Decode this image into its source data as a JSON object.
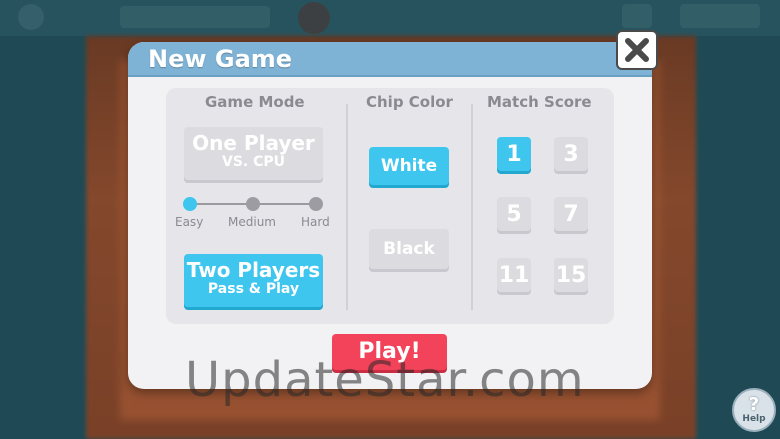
{
  "dialog": {
    "title": "New Game",
    "close_icon": "close-x-icon"
  },
  "game_mode": {
    "label": "Game Mode",
    "one_player": {
      "title": "One Player",
      "subtitle": "VS. CPU",
      "selected": false
    },
    "difficulty": {
      "options": [
        "Easy",
        "Medium",
        "Hard"
      ],
      "selected": "Easy"
    },
    "two_players": {
      "title": "Two Players",
      "subtitle": "Pass & Play",
      "selected": true
    }
  },
  "chip_color": {
    "label": "Chip Color",
    "options": [
      "White",
      "Black"
    ],
    "selected": "White"
  },
  "match_score": {
    "label": "Match Score",
    "options": [
      "1",
      "3",
      "5",
      "7",
      "11",
      "15"
    ],
    "selected": "1"
  },
  "play_button": "Play!",
  "watermark": "UpdateStar.com",
  "help": {
    "label": "Help",
    "symbol": "?"
  },
  "colors": {
    "accent_blue": "#3fc6ee",
    "play_red": "#f2435a",
    "header_blue": "#7fb3d6",
    "inactive_grey": "#dcdce0"
  }
}
